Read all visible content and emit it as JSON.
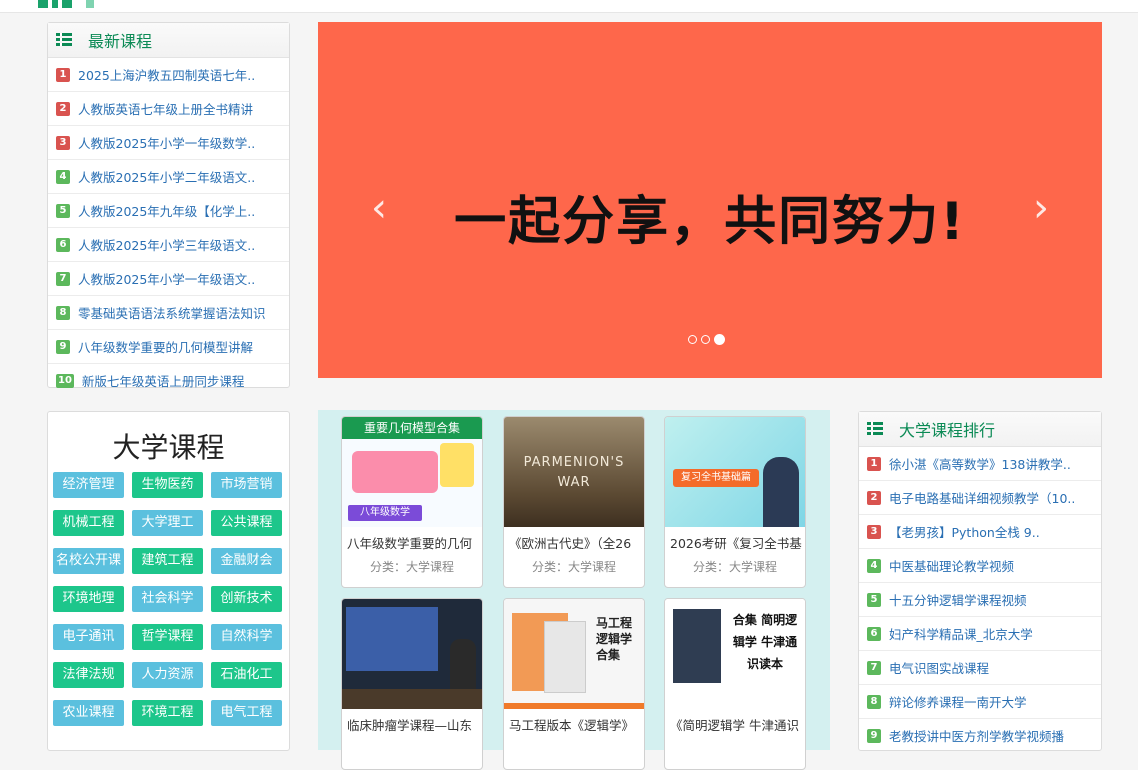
{
  "colors": {
    "accent_green": "#0b8a55",
    "banner": "#fe674b",
    "link": "#2a6fb3",
    "rank_top": "#d9534f",
    "rank_rest": "#5cb85c"
  },
  "latest": {
    "title": "最新课程",
    "items": [
      {
        "num": "1",
        "label": "2025上海沪教五四制英语七年.."
      },
      {
        "num": "2",
        "label": "人教版英语七年级上册全书精讲"
      },
      {
        "num": "3",
        "label": "人教版2025年小学一年级数学.."
      },
      {
        "num": "4",
        "label": "人教版2025年小学二年级语文.."
      },
      {
        "num": "5",
        "label": "人教版2025年九年级【化学上.."
      },
      {
        "num": "6",
        "label": "人教版2025年小学三年级语文.."
      },
      {
        "num": "7",
        "label": "人教版2025年小学一年级语文.."
      },
      {
        "num": "8",
        "label": "零基础英语语法系统掌握语法知识"
      },
      {
        "num": "9",
        "label": "八年级数学重要的几何模型讲解"
      },
      {
        "num": "10",
        "label": "新版七年级英语上册同步课程"
      }
    ]
  },
  "banner": {
    "text": "一起分享，共同努力!",
    "prev_icon": "chevron-left",
    "next_icon": "chevron-right",
    "active_slide": 3,
    "slide_count": 3
  },
  "categories": {
    "title": "大学课程",
    "items": [
      "经济管理",
      "生物医药",
      "市场营销",
      "机械工程",
      "大学理工",
      "公共课程",
      "名校公开课",
      "建筑工程",
      "金融财会",
      "环境地理",
      "社会科学",
      "创新技术",
      "电子通讯",
      "哲学课程",
      "自然科学",
      "法律法规",
      "人力资源",
      "石油化工",
      "农业课程",
      "环境工程",
      "电气工程"
    ]
  },
  "courses": [
    {
      "title": "八年级数学重要的几何",
      "category": "分类：大学课程",
      "thumb_banner": "重要几何模型合集",
      "thumb_sub": "八年级数学"
    },
    {
      "title": "《欧洲古代史》（全26",
      "category": "分类：大学课程",
      "thumb_text": "PARMENION'S WAR"
    },
    {
      "title": "2026考研《复习全书基",
      "category": "分类：大学课程",
      "thumb_text": "复习全书基础篇"
    },
    {
      "title": "临床肿瘤学课程—山东",
      "category": "",
      "thumb_text": ""
    },
    {
      "title": "马工程版本《逻辑学》",
      "category": "",
      "thumb_text": "马工程逻辑学合集"
    },
    {
      "title": "《简明逻辑学 牛津通识",
      "category": "",
      "thumb_text": "合集 简明逻辑学 牛津通识读本"
    }
  ],
  "ranking": {
    "title": "大学课程排行",
    "items": [
      {
        "num": "1",
        "label": "徐小湛《高等数学》138讲教学.."
      },
      {
        "num": "2",
        "label": "电子电路基础详细视频教学（10.."
      },
      {
        "num": "3",
        "label": "【老男孩】Python全栈 9.."
      },
      {
        "num": "4",
        "label": "中医基础理论教学视频"
      },
      {
        "num": "5",
        "label": "十五分钟逻辑学课程视频"
      },
      {
        "num": "6",
        "label": "妇产科学精品课_北京大学"
      },
      {
        "num": "7",
        "label": "电气识图实战课程"
      },
      {
        "num": "8",
        "label": "辩论修养课程一南开大学"
      },
      {
        "num": "9",
        "label": "老教授讲中医方剂学教学视频播"
      }
    ]
  }
}
